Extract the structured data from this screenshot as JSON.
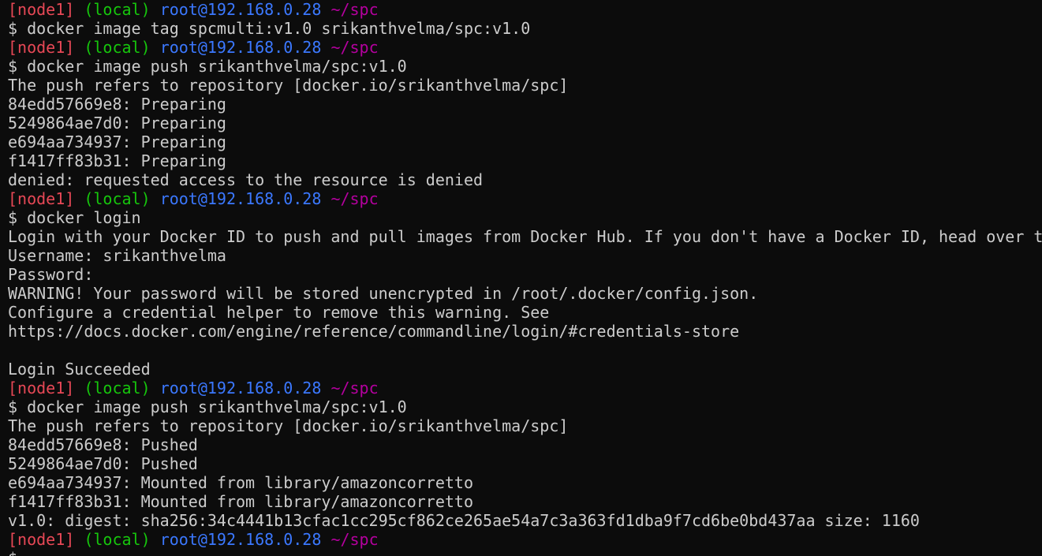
{
  "prompt": {
    "node": "[node1]",
    "local": "(local)",
    "user": "root@192.168.0.28",
    "path": "~/spc"
  },
  "colors": {
    "background": "#0c0c0c",
    "text": "#cccccc",
    "node": "#e74856",
    "local": "#16c60c",
    "user": "#3b78ff",
    "path": "#b4009e"
  },
  "lines": [
    {
      "type": "prompt"
    },
    {
      "type": "text",
      "text": "$ docker image tag spcmulti:v1.0 srikanthvelma/spc:v1.0"
    },
    {
      "type": "prompt"
    },
    {
      "type": "text",
      "text": "$ docker image push srikanthvelma/spc:v1.0"
    },
    {
      "type": "text",
      "text": "The push refers to repository [docker.io/srikanthvelma/spc]"
    },
    {
      "type": "text",
      "text": "84edd57669e8: Preparing"
    },
    {
      "type": "text",
      "text": "5249864ae7d0: Preparing"
    },
    {
      "type": "text",
      "text": "e694aa734937: Preparing"
    },
    {
      "type": "text",
      "text": "f1417ff83b31: Preparing"
    },
    {
      "type": "text",
      "text": "denied: requested access to the resource is denied"
    },
    {
      "type": "prompt"
    },
    {
      "type": "text",
      "text": "$ docker login"
    },
    {
      "type": "text",
      "text": "Login with your Docker ID to push and pull images from Docker Hub. If you don't have a Docker ID, head over to"
    },
    {
      "type": "text",
      "text": "Username: srikanthvelma"
    },
    {
      "type": "text",
      "text": "Password:"
    },
    {
      "type": "text",
      "text": "WARNING! Your password will be stored unencrypted in /root/.docker/config.json."
    },
    {
      "type": "text",
      "text": "Configure a credential helper to remove this warning. See"
    },
    {
      "type": "text",
      "text": "https://docs.docker.com/engine/reference/commandline/login/#credentials-store"
    },
    {
      "type": "text",
      "text": ""
    },
    {
      "type": "text",
      "text": "Login Succeeded"
    },
    {
      "type": "prompt"
    },
    {
      "type": "text",
      "text": "$ docker image push srikanthvelma/spc:v1.0"
    },
    {
      "type": "text",
      "text": "The push refers to repository [docker.io/srikanthvelma/spc]"
    },
    {
      "type": "text",
      "text": "84edd57669e8: Pushed"
    },
    {
      "type": "text",
      "text": "5249864ae7d0: Pushed"
    },
    {
      "type": "text",
      "text": "e694aa734937: Mounted from library/amazoncorretto"
    },
    {
      "type": "text",
      "text": "f1417ff83b31: Mounted from library/amazoncorretto"
    },
    {
      "type": "text",
      "text": "v1.0: digest: sha256:34c4441b13cfac1cc295cf862ce265ae54a7c3a363fd1dba9f7cd6be0bd437aa size: 1160"
    },
    {
      "type": "prompt"
    },
    {
      "type": "text",
      "text": "$"
    }
  ]
}
